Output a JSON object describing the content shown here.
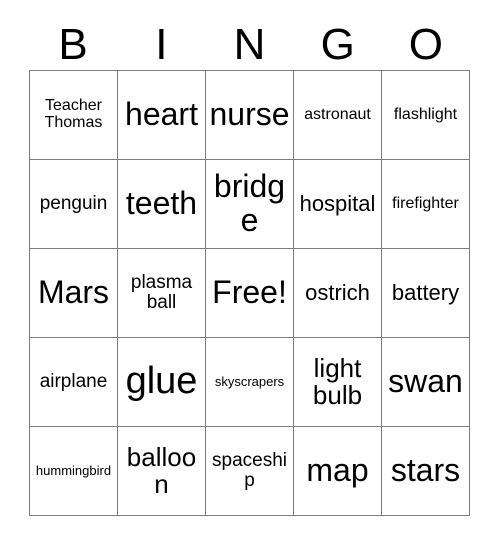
{
  "card": {
    "title": "BINGO",
    "headers": [
      "B",
      "I",
      "N",
      "G",
      "O"
    ],
    "rows": [
      [
        {
          "text": "Teacher Thomas",
          "size": "s"
        },
        {
          "text": "heart",
          "size": "xl"
        },
        {
          "text": "nurse",
          "size": "xl"
        },
        {
          "text": "astronaut",
          "size": "s"
        },
        {
          "text": "flashlight",
          "size": "s"
        }
      ],
      [
        {
          "text": "penguin",
          "size": "m"
        },
        {
          "text": "teeth",
          "size": "xl"
        },
        {
          "text": "bridge",
          "size": "xl"
        },
        {
          "text": "hospital",
          "size": "ml"
        },
        {
          "text": "firefighter",
          "size": "s"
        }
      ],
      [
        {
          "text": "Mars",
          "size": "xl"
        },
        {
          "text": "plasma ball",
          "size": "m"
        },
        {
          "text": "Free!",
          "size": "xl"
        },
        {
          "text": "ostrich",
          "size": "ml"
        },
        {
          "text": "battery",
          "size": "ml"
        }
      ],
      [
        {
          "text": "airplane",
          "size": "m"
        },
        {
          "text": "glue",
          "size": "xxl"
        },
        {
          "text": "skyscrapers",
          "size": "xs"
        },
        {
          "text": "light bulb",
          "size": "l"
        },
        {
          "text": "swan",
          "size": "xl"
        }
      ],
      [
        {
          "text": "hummingbird",
          "size": "xs"
        },
        {
          "text": "balloon",
          "size": "l"
        },
        {
          "text": "spaceship",
          "size": "m"
        },
        {
          "text": "map",
          "size": "xl"
        },
        {
          "text": "stars",
          "size": "xl"
        }
      ]
    ],
    "colors": {
      "border": "#7d7d7d",
      "text": "#000000",
      "background": "#ffffff"
    }
  }
}
